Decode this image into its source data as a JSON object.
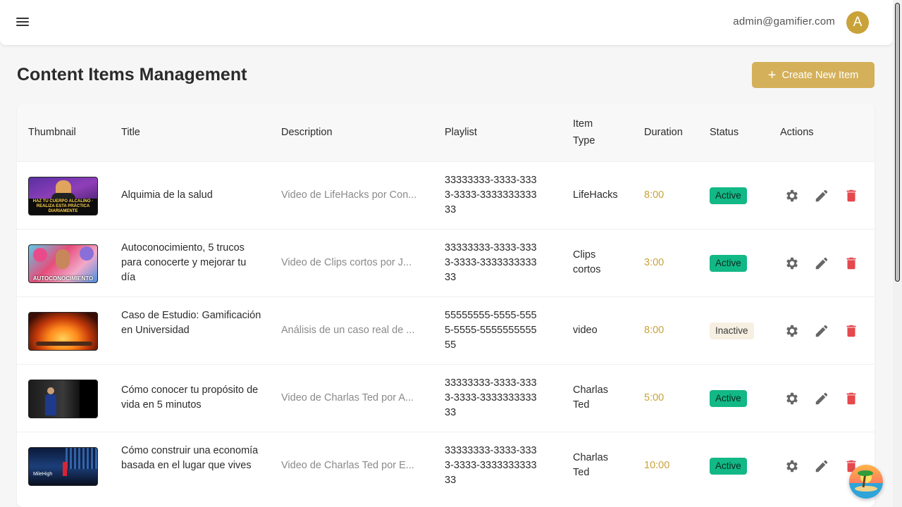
{
  "header": {
    "email": "admin@gamifier.com",
    "avatar_letter": "A"
  },
  "page": {
    "title": "Content Items Management",
    "create_label": "Create New Item"
  },
  "table": {
    "columns": {
      "thumbnail": "Thumbnail",
      "title": "Title",
      "description": "Description",
      "playlist": "Playlist",
      "item_type": "Item Type",
      "duration": "Duration",
      "status": "Status",
      "actions": "Actions"
    },
    "rows": [
      {
        "thumb_text": "HAZ TU CUERPO ALCALINO · REALIZA ESTA PRÁCTICA DIARIAMENTE",
        "title": "Alquimia de la salud",
        "description": "Video de LifeHacks por Con...",
        "playlist": "33333333-3333-3333-3333-333333333333",
        "item_type": "LifeHacks",
        "duration": "8:00",
        "status": "Active"
      },
      {
        "thumb_text": "AUTOCONOCIMIENTO",
        "title": "Autoconocimiento, 5 trucos para conocerte y mejorar tu día",
        "description": "Video de Clips cortos por J...",
        "playlist": "33333333-3333-3333-3333-333333333333",
        "item_type": "Clips cortos",
        "duration": "3:00",
        "status": "Active"
      },
      {
        "thumb_text": "",
        "title": "Caso de Estudio: Gamificación en Universidad",
        "description": "Análisis de un caso real de ...",
        "playlist": "55555555-5555-5555-5555-555555555555",
        "item_type": "video",
        "duration": "8:00",
        "status": "Inactive"
      },
      {
        "thumb_text": "",
        "title": "Cómo conocer tu propósito de vida en 5 minutos",
        "description": "Video de Charlas Ted por A...",
        "playlist": "33333333-3333-3333-3333-333333333333",
        "item_type": "Charlas Ted",
        "duration": "5:00",
        "status": "Active"
      },
      {
        "thumb_text": "MileHigh",
        "title": "Cómo construir una economía basada en el lugar que vives",
        "description": "Video de Charlas Ted por E...",
        "playlist": "33333333-3333-3333-3333-333333333333",
        "item_type": "Charlas Ted",
        "duration": "10:00",
        "status": "Active"
      }
    ]
  },
  "colors": {
    "accent": "#d4b05a",
    "active": "#12b886",
    "delete": "#e5484d"
  }
}
